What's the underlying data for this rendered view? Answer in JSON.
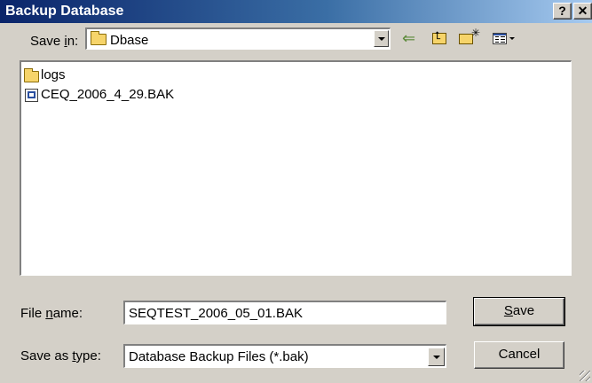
{
  "window": {
    "title": "Backup Database",
    "help_label": "?",
    "close_label": "✕"
  },
  "save_in": {
    "label_prefix": "Save ",
    "label_underlined": "i",
    "label_suffix": "n:",
    "value": "Dbase"
  },
  "toolbar": {
    "back_icon": "back-arrow-icon",
    "back_glyph": "⇐",
    "up_icon": "up-folder-icon",
    "new_folder_icon": "new-folder-icon",
    "new_folder_glyph": "✳",
    "view_menu_icon": "view-menu-icon"
  },
  "files": [
    {
      "name": "logs",
      "icon": "folder-icon"
    },
    {
      "name": "CEQ_2006_4_29.BAK",
      "icon": "backup-file-icon"
    }
  ],
  "file_name": {
    "label_prefix": "File ",
    "label_underlined": "n",
    "label_suffix": "ame:",
    "value": "SEQTEST_2006_05_01.BAK"
  },
  "save_as_type": {
    "label_prefix": "Save as ",
    "label_underlined": "t",
    "label_suffix": "ype:",
    "value": "Database Backup Files (*.bak)"
  },
  "buttons": {
    "save_prefix": "",
    "save_underlined": "S",
    "save_suffix": "ave",
    "cancel": "Cancel"
  },
  "colors": {
    "titlebar_start": "#0a246a",
    "titlebar_end": "#a6caf0",
    "dialog_bg": "#d4d0c8"
  }
}
